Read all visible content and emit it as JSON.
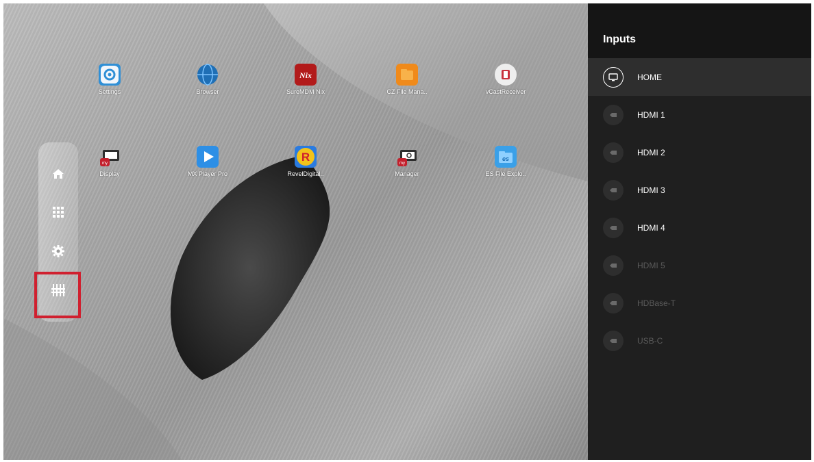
{
  "apps": [
    {
      "label": "Settings",
      "icon": "settings-gear-icon",
      "color": "#2f8fd6"
    },
    {
      "label": "Browser",
      "icon": "globe-icon",
      "color": "#1f6fb5"
    },
    {
      "label": "SureMDM Nix",
      "icon": "nix-logo-icon",
      "color": "#b21a1a"
    },
    {
      "label": "CZ File Mana..",
      "icon": "cz-folder-icon",
      "color": "#f08a1a"
    },
    {
      "label": "vCastReceiver",
      "icon": "vcast-icon",
      "color": "#e8e8e8"
    },
    {
      "label": "Display",
      "icon": "cast-display-icon",
      "color": "#444444"
    },
    {
      "label": "MX Player Pro",
      "icon": "play-icon",
      "color": "#2d8fe6"
    },
    {
      "label": "RevelDigital..",
      "icon": "revel-r-icon",
      "color": "#f2c21a"
    },
    {
      "label": "Manager",
      "icon": "manager-gear-icon",
      "color": "#444444"
    },
    {
      "label": "ES File Explo..",
      "icon": "es-folder-icon",
      "color": "#3aa0e8"
    }
  ],
  "sidebar": {
    "items": [
      {
        "icon": "home-icon"
      },
      {
        "icon": "apps-grid-icon"
      },
      {
        "icon": "settings-icon"
      },
      {
        "icon": "input-source-icon",
        "highlighted": true
      }
    ]
  },
  "inputs_panel": {
    "title": "Inputs",
    "items": [
      {
        "label": "HOME",
        "state": "selected"
      },
      {
        "label": "HDMI 1",
        "state": "enabled"
      },
      {
        "label": "HDMI 2",
        "state": "enabled"
      },
      {
        "label": "HDMI 3",
        "state": "enabled"
      },
      {
        "label": "HDMI 4",
        "state": "enabled"
      },
      {
        "label": "HDMI 5",
        "state": "disabled"
      },
      {
        "label": "HDBase-T",
        "state": "disabled"
      },
      {
        "label": "USB-C",
        "state": "disabled"
      }
    ]
  },
  "colors": {
    "highlight": "#d0202f",
    "panel_bg": "#1f1f1f",
    "selected_row": "#2e2e2e"
  }
}
